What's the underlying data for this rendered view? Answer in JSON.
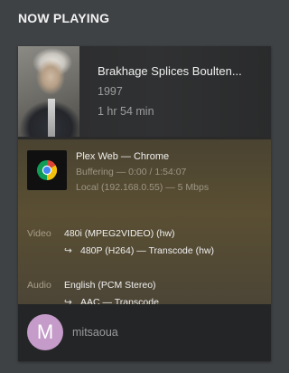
{
  "section": {
    "title": "NOW PLAYING"
  },
  "media": {
    "title": "Brakhage Splices Boulten...",
    "year": "1997",
    "duration": "1 hr 54 min",
    "progress_fraction": 0.0
  },
  "player": {
    "line": "Plex Web  —  Chrome",
    "state": "Buffering — 0:00 / 1:54:07",
    "location": "Local (192.168.0.55) — 5 Mbps",
    "icon": "chrome-icon"
  },
  "video": {
    "label": "Video",
    "source": "480i (MPEG2VIDEO) (hw)",
    "arrow": "↪",
    "target": "480P (H264) — Transcode (hw)"
  },
  "audio": {
    "label": "Audio",
    "source": "English (PCM Stereo)",
    "arrow": "↪",
    "target": "AAC — Transcode"
  },
  "user": {
    "initial": "M",
    "name": "mitsaoua",
    "avatar_color": "#c59bc9"
  },
  "colors": {
    "background": "#3f4245",
    "card": "#1d1e20",
    "details_background": "#544a33",
    "accent": "#e5a00d"
  }
}
